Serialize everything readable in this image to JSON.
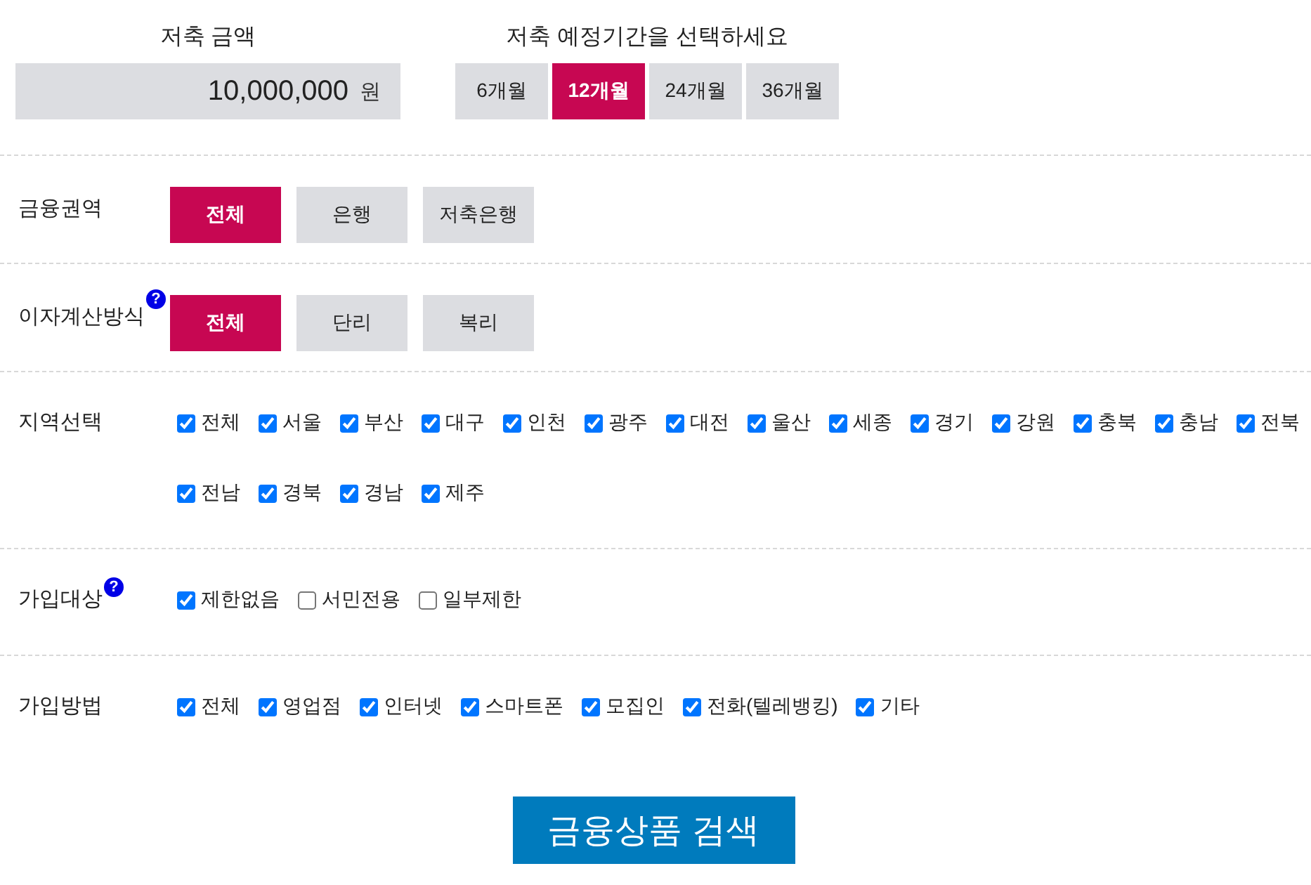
{
  "savings": {
    "amount_label": "저축 금액",
    "amount": "10,000,000",
    "unit": "원",
    "period_label": "저축 예정기간을 선택하세요",
    "periods": [
      {
        "label": "6개월",
        "selected": false
      },
      {
        "label": "12개월",
        "selected": true
      },
      {
        "label": "24개월",
        "selected": false
      },
      {
        "label": "36개월",
        "selected": false
      }
    ]
  },
  "filters": [
    {
      "kind": "buttons",
      "label": "금융권역",
      "options": [
        {
          "label": "전체",
          "selected": true
        },
        {
          "label": "은행",
          "selected": false
        },
        {
          "label": "저축은행",
          "selected": false
        }
      ]
    },
    {
      "kind": "buttons",
      "label": "이자계산방식",
      "help": "?",
      "options": [
        {
          "label": "전체",
          "selected": true
        },
        {
          "label": "단리",
          "selected": false
        },
        {
          "label": "복리",
          "selected": false
        }
      ]
    },
    {
      "kind": "checkboxes",
      "label": "지역선택",
      "options": [
        {
          "label": "전체",
          "checked": true
        },
        {
          "label": "서울",
          "checked": true
        },
        {
          "label": "부산",
          "checked": true
        },
        {
          "label": "대구",
          "checked": true
        },
        {
          "label": "인천",
          "checked": true
        },
        {
          "label": "광주",
          "checked": true
        },
        {
          "label": "대전",
          "checked": true
        },
        {
          "label": "울산",
          "checked": true
        },
        {
          "label": "세종",
          "checked": true
        },
        {
          "label": "경기",
          "checked": true
        },
        {
          "label": "강원",
          "checked": true
        },
        {
          "label": "충북",
          "checked": true
        },
        {
          "label": "충남",
          "checked": true
        },
        {
          "label": "전북",
          "checked": true
        },
        {
          "label": "전남",
          "checked": true
        },
        {
          "label": "경북",
          "checked": true
        },
        {
          "label": "경남",
          "checked": true
        },
        {
          "label": "제주",
          "checked": true
        }
      ]
    },
    {
      "kind": "checkboxes",
      "label": "가입대상",
      "help": "?",
      "options": [
        {
          "label": "제한없음",
          "checked": true
        },
        {
          "label": "서민전용",
          "checked": false
        },
        {
          "label": "일부제한",
          "checked": false
        }
      ]
    },
    {
      "kind": "checkboxes",
      "label": "가입방법",
      "options": [
        {
          "label": "전체",
          "checked": true
        },
        {
          "label": "영업점",
          "checked": true
        },
        {
          "label": "인터넷",
          "checked": true
        },
        {
          "label": "스마트폰",
          "checked": true
        },
        {
          "label": "모집인",
          "checked": true
        },
        {
          "label": "전화(텔레뱅킹)",
          "checked": true
        },
        {
          "label": "기타",
          "checked": true
        }
      ]
    }
  ],
  "search_button": "금융상품 검색"
}
